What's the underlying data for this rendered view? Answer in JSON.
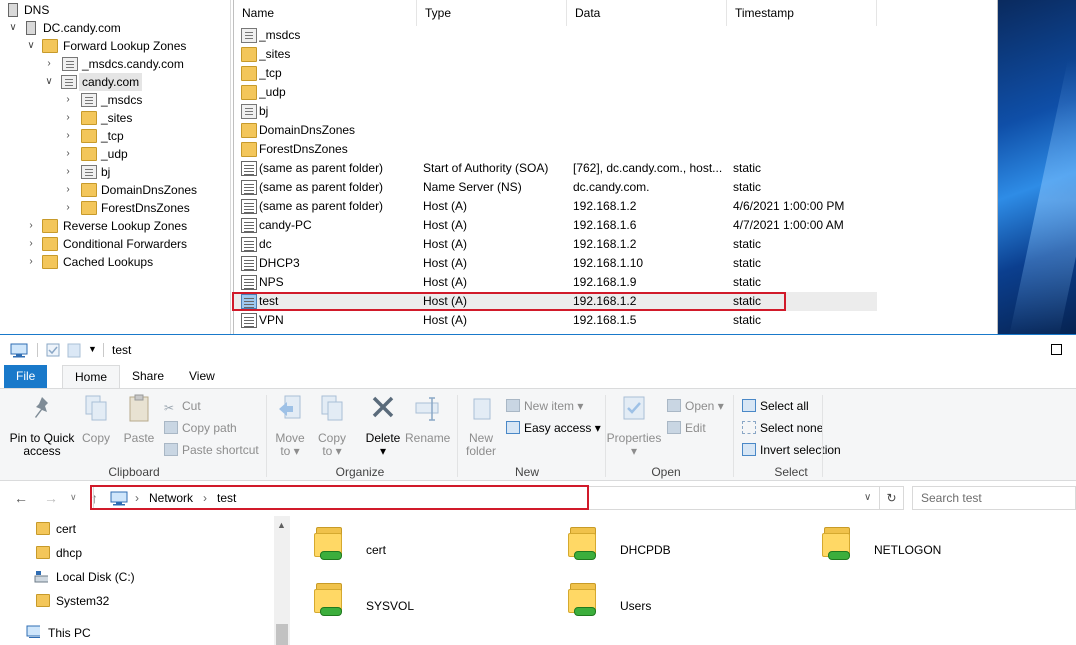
{
  "dns_tree": {
    "items": [
      {
        "label": "DNS"
      },
      {
        "label": "DC.candy.com"
      },
      {
        "label": "Forward Lookup Zones"
      },
      {
        "label": "_msdcs.candy.com"
      },
      {
        "label": "candy.com"
      },
      {
        "label": "_msdcs"
      },
      {
        "label": "_sites"
      },
      {
        "label": "_tcp"
      },
      {
        "label": "_udp"
      },
      {
        "label": "bj"
      },
      {
        "label": "DomainDnsZones"
      },
      {
        "label": "ForestDnsZones"
      },
      {
        "label": "Reverse Lookup Zones"
      },
      {
        "label": "Conditional Forwarders"
      },
      {
        "label": "Cached Lookups"
      }
    ]
  },
  "dns_list": {
    "columns": [
      "Name",
      "Type",
      "Data",
      "Timestamp"
    ],
    "rows": [
      {
        "name": "_msdcs",
        "type": "",
        "data": "",
        "timestamp": ""
      },
      {
        "name": "_sites",
        "type": "",
        "data": "",
        "timestamp": ""
      },
      {
        "name": "_tcp",
        "type": "",
        "data": "",
        "timestamp": ""
      },
      {
        "name": "_udp",
        "type": "",
        "data": "",
        "timestamp": ""
      },
      {
        "name": "bj",
        "type": "",
        "data": "",
        "timestamp": ""
      },
      {
        "name": "DomainDnsZones",
        "type": "",
        "data": "",
        "timestamp": ""
      },
      {
        "name": "ForestDnsZones",
        "type": "",
        "data": "",
        "timestamp": ""
      },
      {
        "name": "(same as parent folder)",
        "type": "Start of Authority (SOA)",
        "data": "[762], dc.candy.com., host...",
        "timestamp": "static"
      },
      {
        "name": "(same as parent folder)",
        "type": "Name Server (NS)",
        "data": "dc.candy.com.",
        "timestamp": "static"
      },
      {
        "name": "(same as parent folder)",
        "type": "Host (A)",
        "data": "192.168.1.2",
        "timestamp": "4/6/2021 1:00:00 PM"
      },
      {
        "name": "candy-PC",
        "type": "Host (A)",
        "data": "192.168.1.6",
        "timestamp": "4/7/2021 1:00:00 AM"
      },
      {
        "name": "dc",
        "type": "Host (A)",
        "data": "192.168.1.2",
        "timestamp": "static"
      },
      {
        "name": "DHCP3",
        "type": "Host (A)",
        "data": "192.168.1.10",
        "timestamp": "static"
      },
      {
        "name": "NPS",
        "type": "Host (A)",
        "data": "192.168.1.9",
        "timestamp": "static"
      },
      {
        "name": "test",
        "type": "Host (A)",
        "data": "192.168.1.2",
        "timestamp": "static"
      },
      {
        "name": "VPN",
        "type": "Host (A)",
        "data": "192.168.1.5",
        "timestamp": "static"
      }
    ]
  },
  "explorer": {
    "title": "test",
    "tabs": {
      "file": "File",
      "home": "Home",
      "share": "Share",
      "view": "View"
    },
    "ribbon": {
      "pin_line1": "Pin to Quick",
      "pin_line2": "access",
      "copy": "Copy",
      "paste": "Paste",
      "cut": "Cut",
      "copy_path": "Copy path",
      "paste_shortcut": "Paste shortcut",
      "clipboard_label": "Clipboard",
      "move_to": "Move",
      "move_to_2": "to",
      "copy_to": "Copy",
      "copy_to_2": "to",
      "delete": "Delete",
      "rename": "Rename",
      "organize_label": "Organize",
      "new_folder_1": "New",
      "new_folder_2": "folder",
      "new_item": "New item",
      "easy_access": "Easy access",
      "new_label": "New",
      "properties": "Properties",
      "open": "Open",
      "edit": "Edit",
      "open_label": "Open",
      "select_all": "Select all",
      "select_none": "Select none",
      "invert_selection": "Invert selection",
      "select_label": "Select"
    },
    "address": {
      "crumbs": [
        "Network",
        "test"
      ],
      "search_placeholder": "Search test"
    },
    "nav_items": [
      {
        "label": "cert",
        "icon": "folder-icon"
      },
      {
        "label": "dhcp",
        "icon": "folder-icon"
      },
      {
        "label": "Local Disk (C:)",
        "icon": "drive-icon"
      },
      {
        "label": "System32",
        "icon": "folder-icon"
      },
      {
        "label": "This PC",
        "icon": "computer-icon"
      }
    ],
    "shares": [
      "cert",
      "DHCPDB",
      "NETLOGON",
      "SYSVOL",
      "Users"
    ]
  },
  "colors": {
    "accent": "#1979ca",
    "highlight_box": "#d11a2a"
  }
}
